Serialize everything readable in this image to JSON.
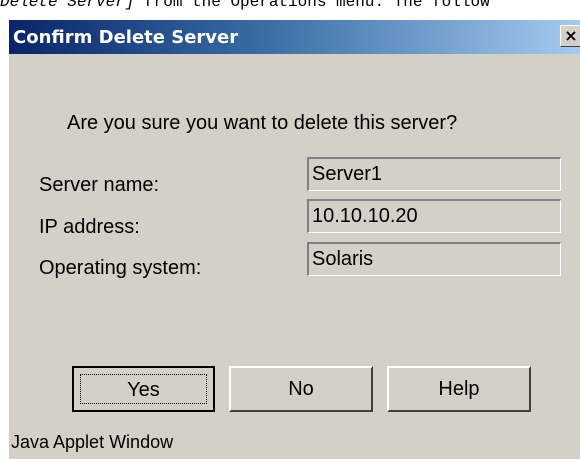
{
  "doc_text": {
    "italic_part": "Delete Server]",
    "rest": " from the Operations menu. The follow"
  },
  "dialog": {
    "title": "Confirm Delete Server",
    "close_label": "×",
    "question": "Are you sure you want to delete this server?",
    "fields": [
      {
        "label": "Server name:",
        "value": "Server1"
      },
      {
        "label": "IP address:",
        "value": "10.10.10.20"
      },
      {
        "label": "Operating system:",
        "value": "Solaris"
      }
    ],
    "buttons": {
      "yes": "Yes",
      "no": "No",
      "help": "Help"
    },
    "footer": "Java Applet Window"
  }
}
